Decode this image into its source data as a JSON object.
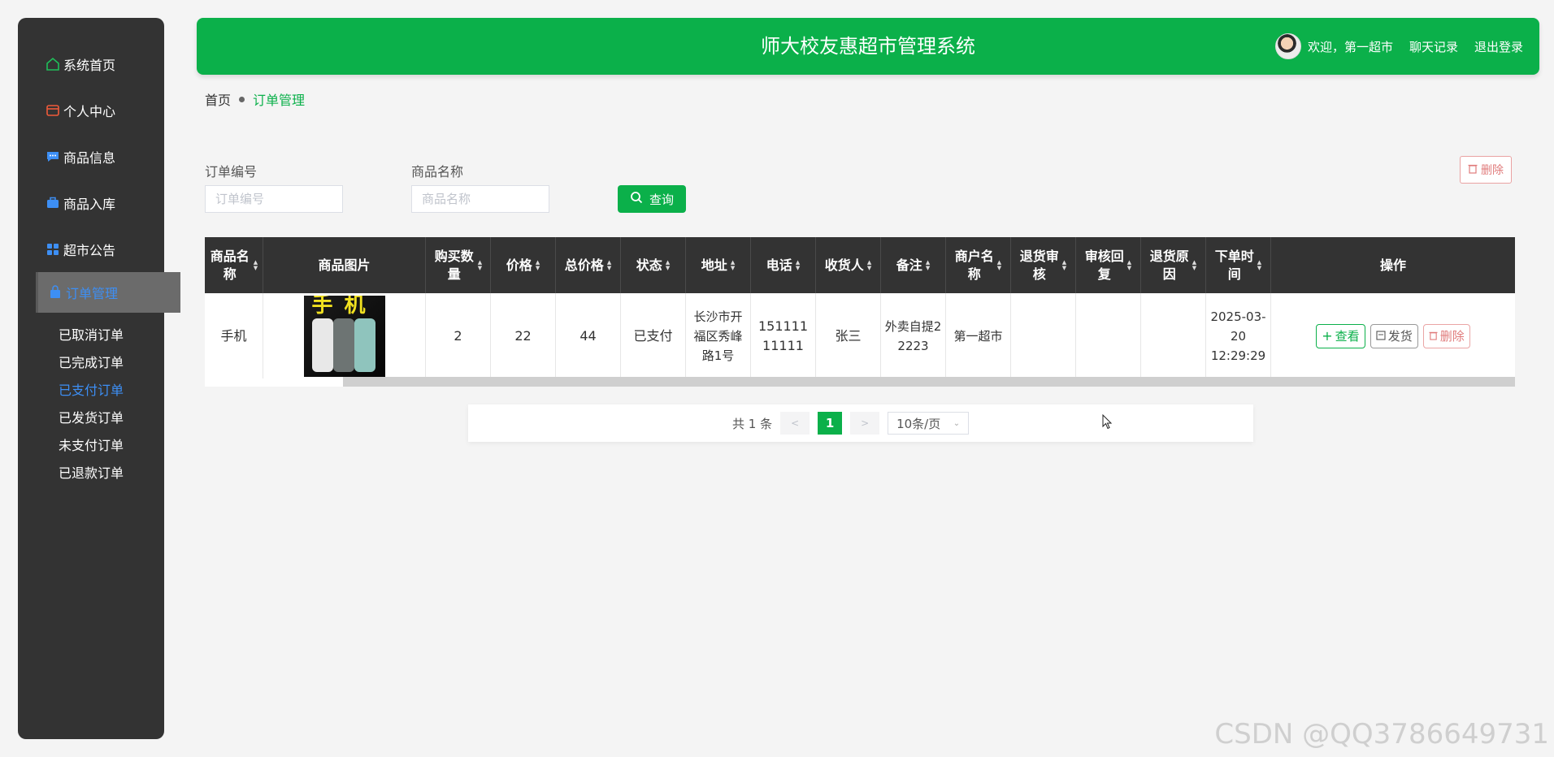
{
  "sidebar": {
    "items": [
      {
        "label": "系统首页",
        "icon": "home-icon"
      },
      {
        "label": "个人中心",
        "icon": "wallet-icon"
      },
      {
        "label": "商品信息",
        "icon": "message-icon"
      },
      {
        "label": "商品入库",
        "icon": "briefcase-icon"
      },
      {
        "label": "超市公告",
        "icon": "grid-icon"
      },
      {
        "label": "订单管理",
        "icon": "bag-icon"
      }
    ],
    "sub_items": [
      "已取消订单",
      "已完成订单",
      "已支付订单",
      "已发货订单",
      "未支付订单",
      "已退款订单"
    ],
    "active_sub": "已支付订单"
  },
  "header": {
    "title": "师大校友惠超市管理系统",
    "welcome": "欢迎，第一超市",
    "chat": "聊天记录",
    "logout": "退出登录"
  },
  "breadcrumb": {
    "home": "首页",
    "current": "订单管理"
  },
  "search": {
    "order_no_label": "订单编号",
    "order_no_placeholder": "订单编号",
    "product_label": "商品名称",
    "product_placeholder": "商品名称",
    "query_label": "查询",
    "delete_label": "删除"
  },
  "table": {
    "headers": [
      "商品名称",
      "商品图片",
      "购买数量",
      "价格",
      "总价格",
      "状态",
      "地址",
      "电话",
      "收货人",
      "备注",
      "商户名称",
      "退货审核",
      "审核回复",
      "退货原因",
      "下单时间",
      "操作"
    ],
    "row": {
      "name": "手机",
      "image_text": "手机",
      "qty": "2",
      "price": "22",
      "total": "44",
      "status": "已支付",
      "address": "长沙市开福区秀峰路1号",
      "phone": "15111111111",
      "receiver": "张三",
      "note": "外卖自提22223",
      "merchant": "第一超市",
      "return_audit": "",
      "audit_reply": "",
      "return_reason": "",
      "order_time": "2025-03-20 12:29:29"
    },
    "actions": {
      "view": "查看",
      "ship": "发货",
      "delete": "删除"
    }
  },
  "pagination": {
    "total": "共 1 条",
    "prev": "<",
    "page": "1",
    "next": ">",
    "page_size": "10条/页"
  },
  "watermark": "CSDN @QQ3786649731",
  "colors": {
    "primary": "#0bb04a",
    "sidebar": "#333333",
    "danger": "#e07b7b",
    "active_link": "#3d8ff5"
  }
}
